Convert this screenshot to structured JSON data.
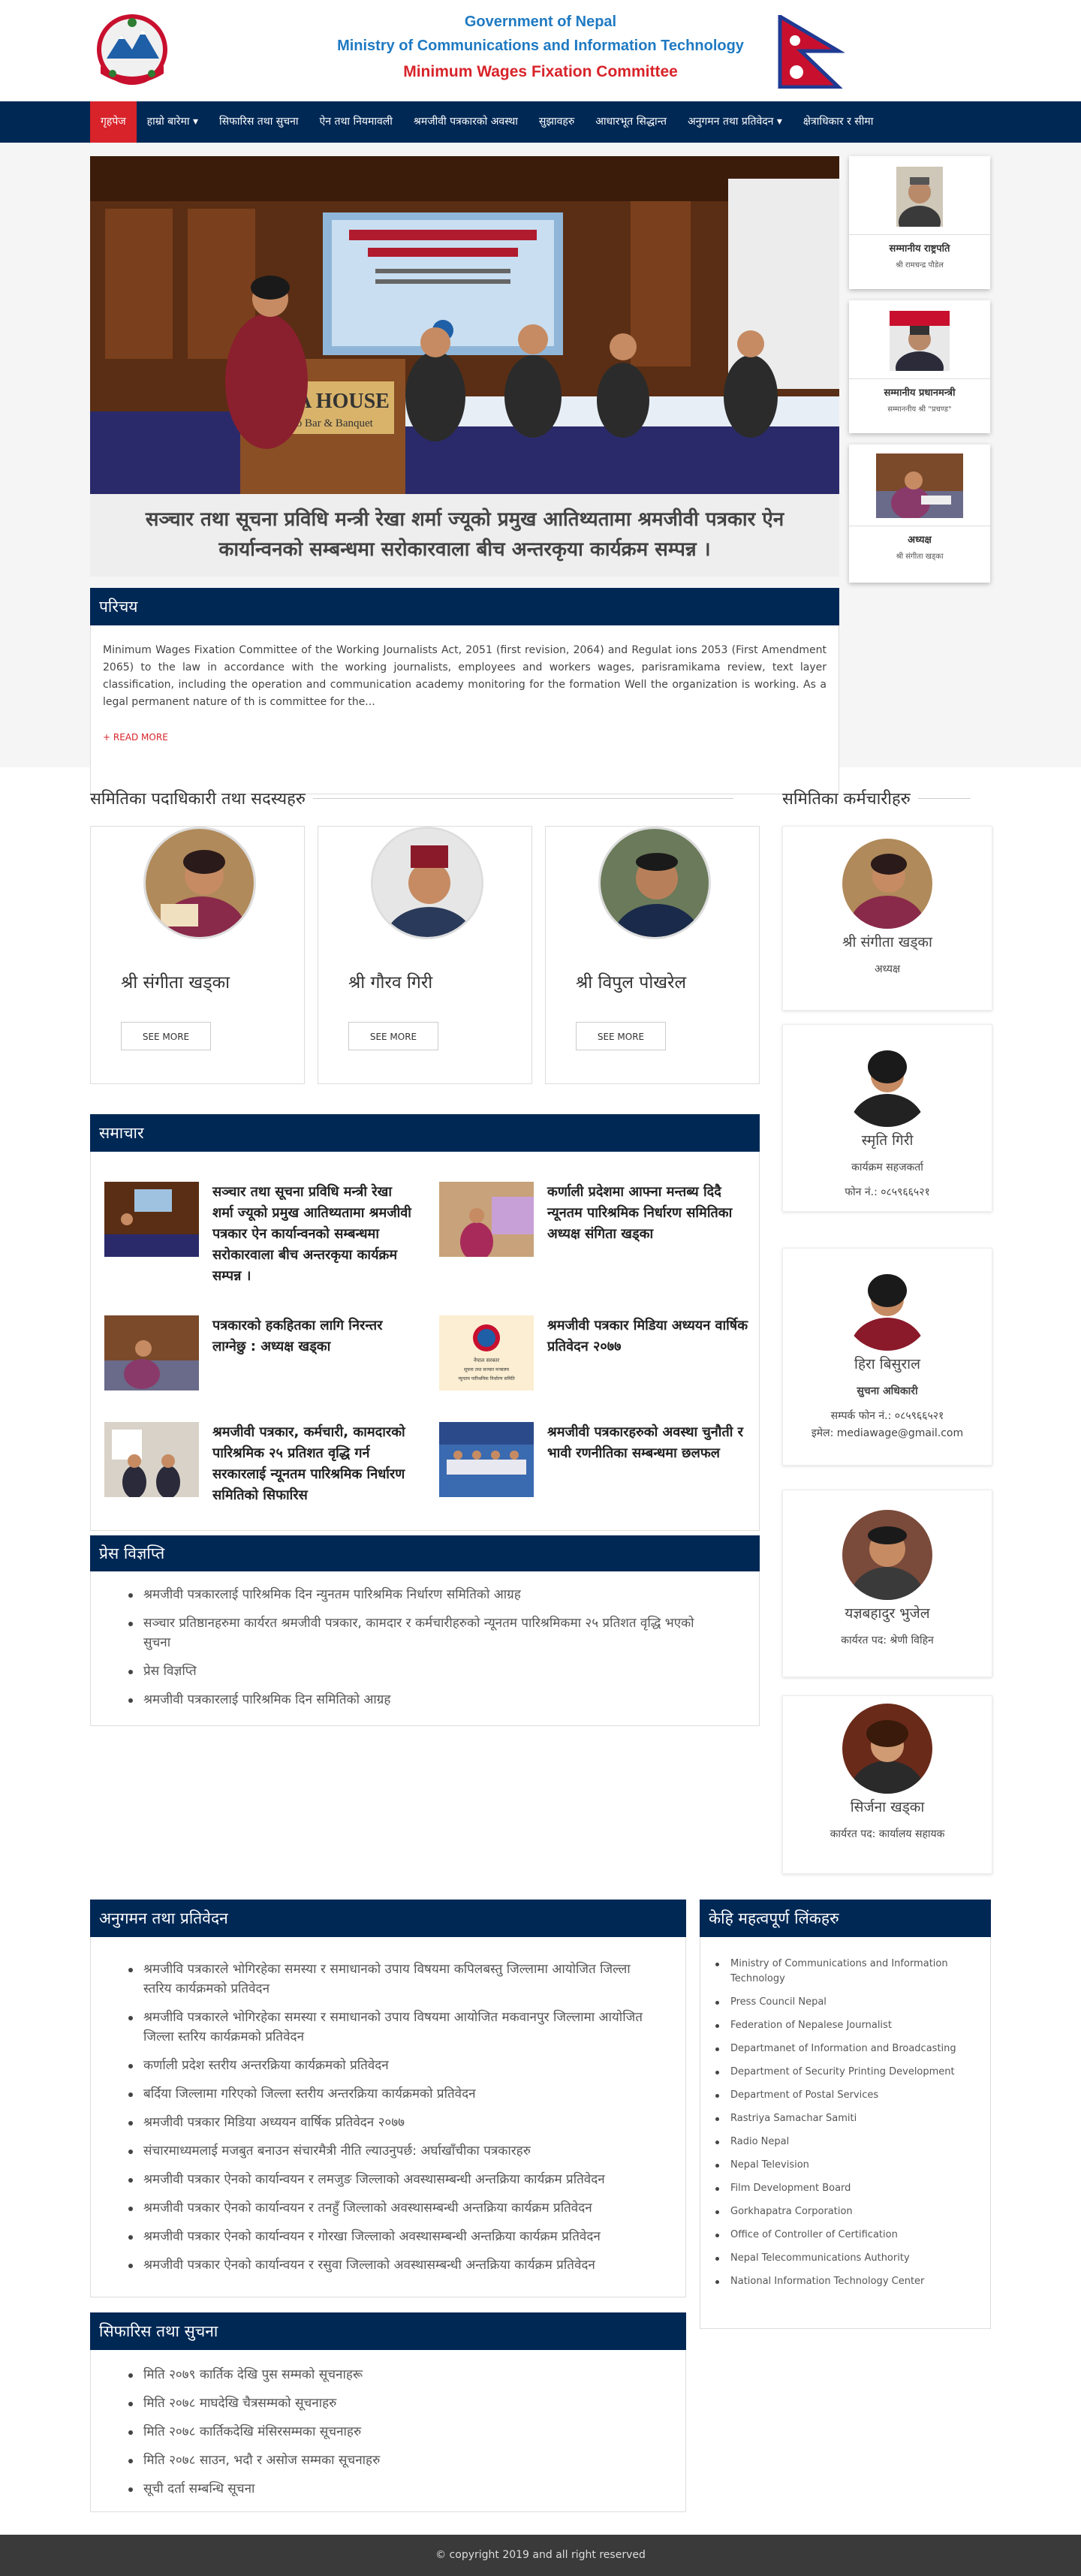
{
  "header": {
    "line1": "Government of Nepal",
    "line2": "Ministry of Communications and Information Technology",
    "line3": "Minimum Wages Fixation Committee"
  },
  "nav": [
    "गृहपेज",
    "हाम्रो बारेमा ▾",
    "सिफारिस तथा सुचना",
    "ऐन तथा नियमावली",
    "श्रमजीवी पत्रकारको अवस्था",
    "सुझावहरु",
    "आधारभूत सिद्धान्त",
    "अनुगमन तथा प्रतिवेदन ▾",
    "क्षेत्राधिकार र सीमा"
  ],
  "hero": {
    "caption": "सञ्चार तथा सूचना प्रविधि मन्त्री रेखा शर्मा ज्यूको प्रमुख आतिथ्यतामा श्रमजीवी पत्रकार ऐन कार्यान्वनको सम्बन्धमा सरोकारवाला बीच अन्तरकृया कार्यक्रम सम्पन्न ।",
    "banner_title": "ALFA HOUSE",
    "banner_sub": "Restro Bar & Banquet"
  },
  "vips": [
    {
      "title": "सम्मानीय राष्ट्रपति",
      "name": "श्री रामचन्द्र पौडेल"
    },
    {
      "title": "सम्मानीय प्रधानमन्त्री",
      "name": "सम्माननीय श्री \"प्रचण्ड\""
    },
    {
      "title": "अध्यक्ष",
      "name": "श्री संगीता खड्का"
    }
  ],
  "intro": {
    "heading": "परिचय",
    "text": "Minimum Wages Fixation Committee of the Working Journalists Act, 2051 (first revision, 2064) and Regulat ions 2053 (First Amendment 2065) to the law in accordance with the working journalists, employees and workers wages, parisramikama review, text layer classification, including the operation and communication academy monitoring for the formation Well the organization is working. As a legal permanent nature of th is committee for the...",
    "more": "+ READ MORE"
  },
  "members_title": "समितिका पदाधिकारी तथा सदस्यहरु",
  "staff_title": "समितिका कर्मचारीहरु",
  "members": [
    {
      "name": "श्री संगीता खड्का",
      "btn": "SEE MORE"
    },
    {
      "name": "श्री गौरव गिरी",
      "btn": "SEE MORE"
    },
    {
      "name": "श्री विपुल पोखरेल",
      "btn": "SEE MORE"
    }
  ],
  "staff": [
    {
      "name": "श्री संगीता खड्का",
      "l1": "अध्यक्ष",
      "l2": "",
      "l3": ""
    },
    {
      "name": "स्मृति गिरी",
      "l1": "कार्यक्रम सहजकर्ता",
      "l2": "फोन नं.: ०८५९६६५२१",
      "l3": ""
    },
    {
      "name": "हिरा बिसुराल",
      "l1": "सुचना अधिकारी",
      "l2": "सम्पर्क फोन नं.: ०८५९६६५२१",
      "l3": "इमेल: mediawage@gmail.com"
    },
    {
      "name": "यज्ञबहादुर भुजेल",
      "l1": "कार्यरत पद: श्रेणी विहिन",
      "l2": "",
      "l3": ""
    },
    {
      "name": "सिर्जना खड्का",
      "l1": "कार्यरत पद: कार्यालय सहायक",
      "l2": "",
      "l3": ""
    }
  ],
  "news": {
    "heading": "समाचार",
    "items": [
      "सञ्चार तथा सूचना प्रविधि मन्त्री रेखा शर्मा ज्यूको प्रमुख आतिथ्यतामा श्रमजीवी पत्रकार ऐन कार्यान्वनको सम्बन्धमा सरोकारवाला बीच अन्तरकृया कार्यक्रम सम्पन्न ।",
      "कर्णाली प्रदेशमा आफ्ना मन्तब्य दिदै न्यूनतम पारिश्रमिक निर्धारण समितिका अध्यक्ष संगिता खड्का",
      "पत्रकारको हकहितका लागि निरन्तर लाग्नेछु : अध्यक्ष खड्का",
      "श्रमजीवी पत्रकार मिडिया अध्ययन वार्षिक प्रतिवेदन २०७७",
      "श्रमजीवी पत्रकार, कर्मचारी, कामदारको पारिश्रमिक २५ प्रतिशत वृद्धि गर्न सरकारलाई न्यूनतम पारिश्रमिक निर्धारण समितिको सिफारिस",
      "श्रमजीवी पत्रकारहरुको अवस्था चुनौती र भावी रणनीतिका सम्बन्धमा छलफल"
    ],
    "poster_text": [
      "नेपाल सरकार",
      "सूचना तथा सञ्चार मन्त्रालय",
      "न्यूनतम पारिश्रमिक निर्धारण समिति"
    ]
  },
  "press": {
    "heading": "प्रेस विज्ञप्ति",
    "items": [
      "श्रमजीवी पत्रकारलाई पारिश्रमिक दिन न्युनतम पारिश्रमिक निर्धारण समितिको आग्रह",
      "सञ्चार प्रतिष्ठानहरुमा कार्यरत श्रमजीवी पत्रकार, कामदार र कर्मचारीहरुको न्यूनतम पारिश्रमिकमा २५ प्रतिशत वृद्धि भएको सुचना",
      "प्रेस विज्ञप्ति",
      "श्रमजीवी पत्रकारलाई पारिश्रमिक दिन समितिको आग्रह"
    ]
  },
  "monitoring": {
    "heading": "अनुगमन तथा प्रतिवेदन",
    "items": [
      "श्रमजीवि पत्रकारले भोगिरहेका समस्या र समाधानको उपाय विषयमा कपिलबस्तु जिल्लामा आयोजित जिल्ला स्तरिय कार्यक्रमको प्रतिवेदन",
      "श्रमजीवि पत्रकारले भोगिरहेका समस्या र समाधानको उपाय विषयमा आयोजित मकवानपुर जिल्लामा आयोजित जिल्ला स्तरिय कार्यक्रमको प्रतिवेदन",
      "कर्णाली प्रदेश स्तरीय अन्तरक्रिया कार्यक्रमको प्रतिवेदन",
      "बर्दिया जिल्लामा गरिएको जिल्ला स्तरीय अन्तरक्रिया कार्यक्रमको प्रतिवेदन",
      "श्रमजीवी पत्रकार मिडिया अध्ययन वार्षिक प्रतिवेदन २०७७",
      "संचारमाध्यमलाई मजबुत बनाउन संचारमैत्री नीति ल्याउनुपर्छ: अर्घाखाँचीका पत्रकारहरु",
      "श्रमजीवी पत्रकार ऐनको कार्यान्वयन र लमजुङ जिल्लाको अवस्थासम्बन्धी अन्तक्रिया कार्यक्रम प्रतिवेदन",
      "श्रमजीवी पत्रकार ऐनको कार्यान्वयन र तनहुँ जिल्लाको अवस्थासम्बन्धी अन्तक्रिया कार्यक्रम प्रतिवेदन",
      "श्रमजीवी पत्रकार ऐनको कार्यान्वयन र गोरखा जिल्लाको अवस्थासम्बन्धी अन्तक्रिया कार्यक्रम प्रतिवेदन",
      "श्रमजीवी पत्रकार ऐनको कार्यान्वयन र रसुवा जिल्लाको अवस्थासम्बन्धी अन्तक्रिया कार्यक्रम प्रतिवेदन"
    ]
  },
  "recommend": {
    "heading": "सिफारिस तथा सुचना",
    "items": [
      "मिति २०७९ कार्तिक देखि पुस सम्मको सूचनाहरू",
      "मिति २०७८ माघदेखि चैत्रसम्मको सूचनाहरु",
      "मिति २०७८ कार्तिकदेखि मंसिरसम्मका सूचनाहरु",
      "मिति २०७८ साउन, भदौ र असोज सम्मका सूचनाहरु",
      "सूची दर्ता सम्बन्धि सूचना"
    ]
  },
  "links": {
    "heading": "केहि महत्वपूर्ण लिंकहरु",
    "items": [
      "Ministry of Communications and Information Technology",
      "Press Council Nepal",
      "Federation of Nepalese Journalist",
      "Departmanet of Information and Broadcasting",
      "Department of Security Printing Development",
      "Department of Postal Services",
      "Rastriya Samachar Samiti",
      "Radio Nepal",
      "Nepal Television",
      "Film Development Board",
      "Gorkhapatra Corporation",
      "Office of Controller of Certification",
      "Nepal Telecommunications Authority",
      "National Information Technology Center"
    ]
  },
  "footer": "© copyright 2019 and all right reserved",
  "colors": {
    "navy": "#002855",
    "red": "#d8232a",
    "blue": "#1f7ac2"
  }
}
